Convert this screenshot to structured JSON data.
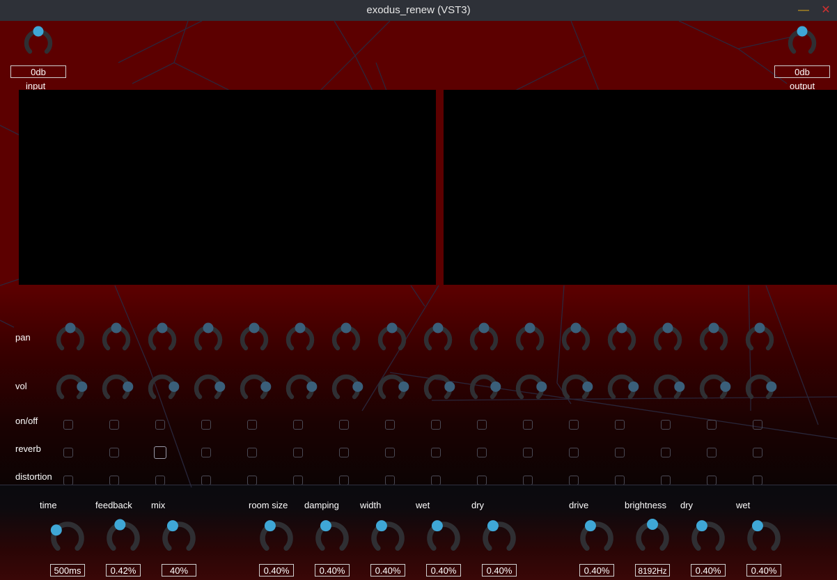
{
  "window": {
    "title": "exodus_renew (VST3)",
    "minimize_glyph": "—",
    "close_glyph": "✕"
  },
  "colors": {
    "knob_track": "#2f2f33",
    "knob_thumb": "#3fa7d6",
    "knob_thumb_dim": "#3a5f7a",
    "background_red": "#5c0000",
    "screen": "#000000"
  },
  "io": {
    "input": {
      "label": "input",
      "value": "0db",
      "level": 0.5
    },
    "output": {
      "label": "output",
      "value": "0db",
      "level": 0.5
    }
  },
  "row_labels": {
    "pan": "pan",
    "vol": "vol",
    "onoff": "on/off",
    "reverb": "reverb",
    "distortion": "distortion"
  },
  "channels": [
    {
      "pan": 0.5,
      "vol": 0.8,
      "on": false,
      "reverb": false,
      "dist": false
    },
    {
      "pan": 0.5,
      "vol": 0.8,
      "on": false,
      "reverb": false,
      "dist": false
    },
    {
      "pan": 0.5,
      "vol": 0.8,
      "on": false,
      "reverb": true,
      "dist": false
    },
    {
      "pan": 0.5,
      "vol": 0.8,
      "on": false,
      "reverb": false,
      "dist": false
    },
    {
      "pan": 0.5,
      "vol": 0.8,
      "on": false,
      "reverb": false,
      "dist": false
    },
    {
      "pan": 0.5,
      "vol": 0.8,
      "on": false,
      "reverb": false,
      "dist": false
    },
    {
      "pan": 0.5,
      "vol": 0.8,
      "on": false,
      "reverb": false,
      "dist": false
    },
    {
      "pan": 0.5,
      "vol": 0.8,
      "on": false,
      "reverb": false,
      "dist": false
    },
    {
      "pan": 0.5,
      "vol": 0.8,
      "on": false,
      "reverb": false,
      "dist": false
    },
    {
      "pan": 0.5,
      "vol": 0.8,
      "on": false,
      "reverb": false,
      "dist": false
    },
    {
      "pan": 0.5,
      "vol": 0.8,
      "on": false,
      "reverb": false,
      "dist": false
    },
    {
      "pan": 0.5,
      "vol": 0.8,
      "on": false,
      "reverb": false,
      "dist": false
    },
    {
      "pan": 0.5,
      "vol": 0.8,
      "on": false,
      "reverb": false,
      "dist": false
    },
    {
      "pan": 0.5,
      "vol": 0.8,
      "on": false,
      "reverb": false,
      "dist": false
    },
    {
      "pan": 0.5,
      "vol": 0.8,
      "on": false,
      "reverb": false,
      "dist": false
    },
    {
      "pan": 0.5,
      "vol": 0.8,
      "on": false,
      "reverb": false,
      "dist": false
    }
  ],
  "delay": {
    "time": {
      "label": "time",
      "value": "500ms",
      "level": 0.3
    },
    "feedback": {
      "label": "feedback",
      "value": "0.42%",
      "level": 0.45
    },
    "mix": {
      "label": "mix",
      "value": "40%",
      "level": 0.4
    }
  },
  "reverb": {
    "room_size": {
      "label": "room size",
      "value": "0.40%",
      "level": 0.4
    },
    "damping": {
      "label": "damping",
      "value": "0.40%",
      "level": 0.4
    },
    "width": {
      "label": "width",
      "value": "0.40%",
      "level": 0.4
    },
    "wet": {
      "label": "wet",
      "value": "0.40%",
      "level": 0.4
    },
    "dry": {
      "label": "dry",
      "value": "0.40%",
      "level": 0.4
    }
  },
  "distortion": {
    "drive": {
      "label": "drive",
      "value": "0.40%",
      "level": 0.4
    },
    "brightness": {
      "label": "brightness",
      "value": "8192Hz",
      "level": 0.5
    },
    "dry": {
      "label": "dry",
      "value": "0.40%",
      "level": 0.4
    },
    "wet": {
      "label": "wet",
      "value": "0.40%",
      "level": 0.4
    }
  }
}
